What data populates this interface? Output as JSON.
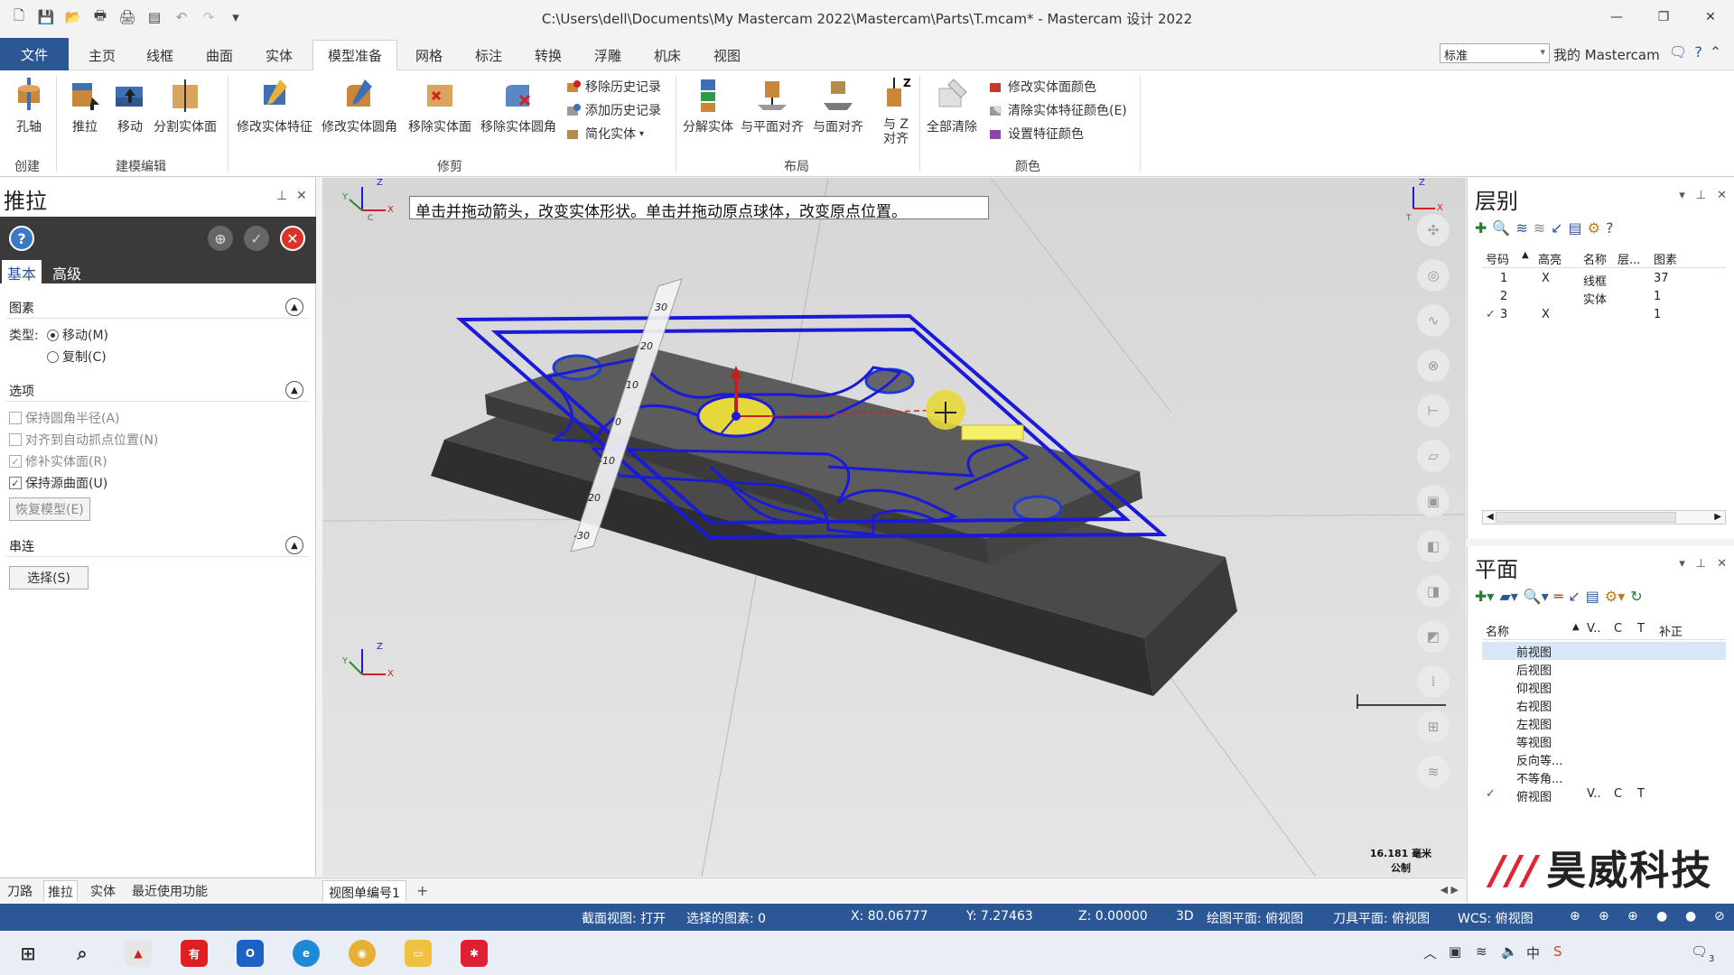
{
  "window": {
    "title": "C:\\Users\\dell\\Documents\\My Mastercam 2022\\Mastercam\\Parts\\T.mcam* - Mastercam 设计 2022"
  },
  "ribbon_tabs": [
    "文件",
    "主页",
    "线框",
    "曲面",
    "实体",
    "模型准备",
    "网格",
    "标注",
    "转换",
    "浮雕",
    "机床",
    "视图"
  ],
  "active_tab": "模型准备",
  "style_select": "标准",
  "my_mastercam": "我的 Mastercam",
  "ribbon": {
    "create": {
      "label": "创建",
      "buttons": [
        "孔轴"
      ]
    },
    "model_edit": {
      "label": "建模编辑",
      "buttons": [
        "推拉",
        "移动",
        "分割实体面"
      ]
    },
    "trim": {
      "label": "修剪",
      "buttons": [
        "修改实体特征",
        "修改实体圆角",
        "移除实体面",
        "移除实体圆角"
      ],
      "small": [
        "移除历史记录",
        "添加历史记录",
        "简化实体"
      ]
    },
    "layout": {
      "label": "布局",
      "buttons": [
        "分解实体",
        "与平面对齐",
        "与面对齐",
        "与 Z 对齐"
      ]
    },
    "color": {
      "label": "颜色",
      "buttons": [
        "全部清除"
      ],
      "small": [
        "修改实体面颜色",
        "清除实体特征颜色(E)",
        "设置特征颜色"
      ]
    }
  },
  "left_panel": {
    "title": "推拉",
    "tabs": [
      "基本",
      "高级"
    ],
    "entities": {
      "header": "图素",
      "type_label": "类型:",
      "move": "移动(M)",
      "copy": "复制(C)"
    },
    "options": {
      "header": "选项",
      "keep_fillet": "保持圆角半径(A)",
      "align_auto": "对齐到自动抓点位置(N)",
      "patch_solid": "修补实体面(R)",
      "keep_source": "保持源曲面(U)",
      "restore_model": "恢复模型(E)"
    },
    "chain": {
      "header": "串连",
      "select": "选择(S)"
    }
  },
  "bottom_left_tabs": [
    "刀路",
    "推拉",
    "实体",
    "最近使用功能"
  ],
  "active_bottom_tab": "推拉",
  "viewport": {
    "hint": "单击并拖动箭头，改变实体形状。单击并拖动原点球体，改变原点位置。",
    "ruler_marks": [
      "30",
      "20",
      "10",
      "0",
      "-10",
      "-20",
      "-30"
    ],
    "scale_value": "16.181 毫米",
    "scale_unit": "公制",
    "axis_x": "X",
    "axis_y": "Y",
    "axis_z": "Z",
    "gnomon_c": "C",
    "gnomon_t": "T"
  },
  "view_tabs": [
    "视图单编号1"
  ],
  "layers": {
    "title": "层别",
    "headers": [
      "号码",
      "高亮",
      "名称",
      "层...",
      "图素"
    ],
    "rows": [
      {
        "check": "",
        "num": "1",
        "hl": "X",
        "name": "线框",
        "count": "37"
      },
      {
        "check": "",
        "num": "2",
        "hl": "",
        "name": "实体",
        "count": "1"
      },
      {
        "check": "✓",
        "num": "3",
        "hl": "X",
        "name": "",
        "count": "1"
      }
    ]
  },
  "planes": {
    "title": "平面",
    "headers": [
      "名称",
      "V..",
      "C",
      "T",
      "补正"
    ],
    "rows": [
      {
        "check": "",
        "name": "前视图",
        "v": "",
        "c": "",
        "t": ""
      },
      {
        "check": "",
        "name": "后视图",
        "v": "",
        "c": "",
        "t": ""
      },
      {
        "check": "",
        "name": "仰视图",
        "v": "",
        "c": "",
        "t": ""
      },
      {
        "check": "",
        "name": "右视图",
        "v": "",
        "c": "",
        "t": ""
      },
      {
        "check": "",
        "name": "左视图",
        "v": "",
        "c": "",
        "t": ""
      },
      {
        "check": "",
        "name": "等视图",
        "v": "",
        "c": "",
        "t": ""
      },
      {
        "check": "",
        "name": "反向等...",
        "v": "",
        "c": "",
        "t": ""
      },
      {
        "check": "",
        "name": "不等角...",
        "v": "",
        "c": "",
        "t": ""
      },
      {
        "check": "✓",
        "name": "俯视图",
        "v": "V..",
        "c": "C",
        "t": "T"
      }
    ]
  },
  "watermark": "昊威科技",
  "status": {
    "section_view": "截面视图: 打开",
    "selected": "选择的图素: 0",
    "x": "X:  80.06777",
    "y": "Y:  7.27463",
    "z": "Z:  0.00000",
    "mode": "3D",
    "cplane": "绘图平面: 俯视图",
    "tplane": "刀具平面: 俯视图",
    "wcs": "WCS: 俯视图"
  },
  "taskbar": {
    "notification_count": "3"
  }
}
